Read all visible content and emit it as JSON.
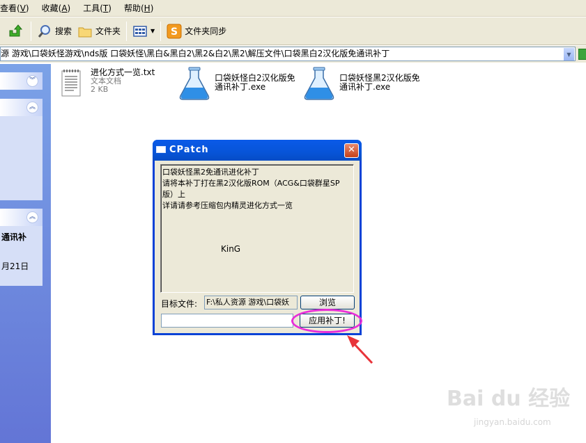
{
  "menubar": {
    "items": [
      {
        "label": "查看",
        "key": "V"
      },
      {
        "label": "收藏",
        "key": "A"
      },
      {
        "label": "工具",
        "key": "T"
      },
      {
        "label": "帮助",
        "key": "H"
      }
    ]
  },
  "toolbar": {
    "search_label": "搜索",
    "folders_label": "文件夹",
    "sync_label": "文件夹同步"
  },
  "address": {
    "value": "源 游戏\\口袋妖怪游戏\\nds版 口袋妖怪\\黑白&黑白2\\黑2&白2\\黑2\\解压文件\\口袋黑白2汉化版免通讯补丁"
  },
  "leftpane": {
    "details_title": "通讯补",
    "details_date": "月21日"
  },
  "files": [
    {
      "name": "进化方式一览.txt",
      "type": "文本文档",
      "size": "2 KB"
    },
    {
      "name": "口袋妖怪白2汉化版免\n通讯补丁.exe"
    },
    {
      "name": "口袋妖怪黑2汉化版免\n通讯补丁.exe"
    }
  ],
  "dialog": {
    "title": "CPatch",
    "close_symbol": "✕",
    "message_lines": [
      "口袋妖怪黑2免通讯进化补丁",
      "请将本补丁打在黑2汉化版ROM（ACG&口袋群星SP",
      "版）上",
      "详请请参考压缩包内精灵进化方式一览"
    ],
    "author": "KinG",
    "target_label": "目标文件:",
    "target_value": "F:\\私人资源 游戏\\口袋妖",
    "browse_label": "浏览",
    "apply_label": "应用补丁!"
  },
  "watermark": {
    "main": "Bai du 经验",
    "sub": "jingyan.baidu.com"
  },
  "colors": {
    "titlebar": "#0754d8",
    "highlight": "#e82ed8",
    "arrow": "#e8343a",
    "leftpane": "#6f8ddf"
  }
}
